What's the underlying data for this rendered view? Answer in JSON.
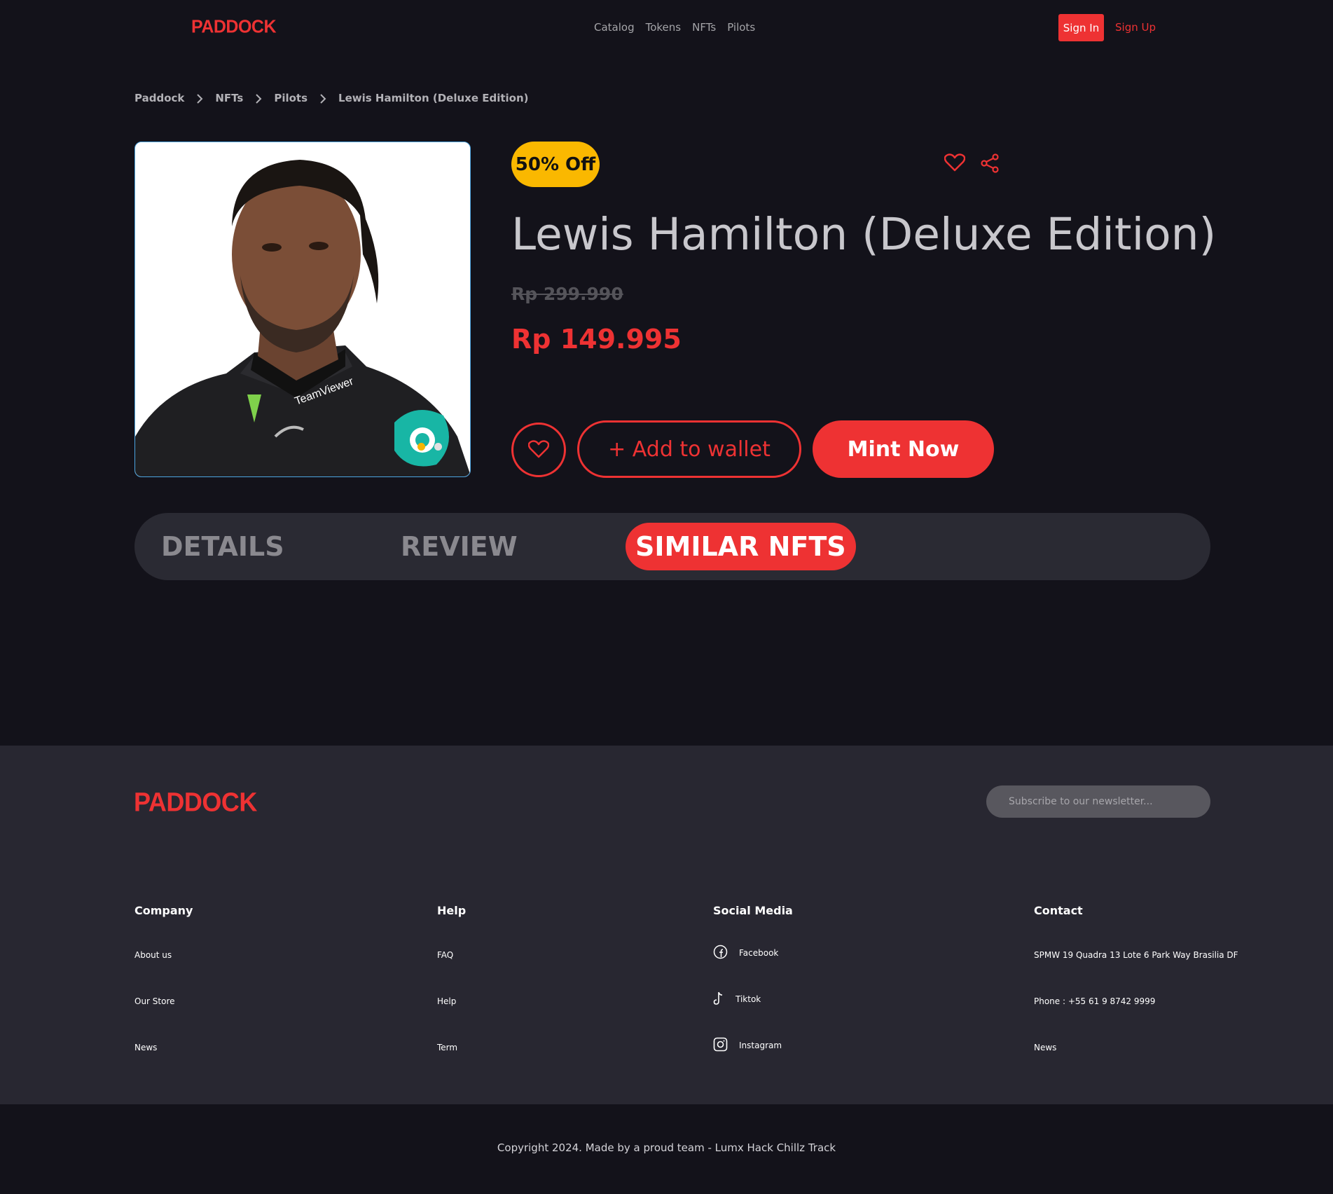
{
  "header": {
    "logo": "PADDOCK",
    "nav": [
      "Catalog",
      "Tokens",
      "NFTs",
      "Pilots"
    ],
    "sign_in": "Sign In",
    "sign_up": "Sign Up"
  },
  "breadcrumb": [
    "Paddock",
    "NFTs",
    "Pilots",
    "Lewis Hamilton (Deluxe Edition)"
  ],
  "product": {
    "badge": "50% Off",
    "title": "Lewis Hamilton (Deluxe Edition)",
    "old_price": "Rp 299.990",
    "new_price": "Rp 149.995",
    "add_to_wallet": "+ Add to wallet",
    "mint_now": "Mint Now"
  },
  "tabs": [
    "DETAILS",
    "REVIEW",
    "SIMILAR NFTS"
  ],
  "footer": {
    "logo": "PADDOCK",
    "newsletter_placeholder": "Subscribe to our newsletter...",
    "columns": {
      "company": {
        "title": "Company",
        "links": [
          "About us",
          "Our Store",
          "News"
        ]
      },
      "help": {
        "title": "Help",
        "links": [
          "FAQ",
          "Help",
          "Term"
        ]
      },
      "social": {
        "title": "Social Media",
        "links": [
          "Facebook",
          "Tiktok",
          "Instagram"
        ]
      },
      "contact": {
        "title": "Contact",
        "links": [
          "SPMW 19 Quadra 13 Lote 6 Park Way Brasilia DF",
          "Phone : +55 61 9 8742 9999",
          "News"
        ]
      }
    },
    "copyright": "Copyright 2024. Made by a proud team - Lumx Hack Chillz Track"
  },
  "colors": {
    "accent": "#ee3233",
    "badge": "#fab800",
    "background": "#13121a",
    "footer": "#282731"
  }
}
